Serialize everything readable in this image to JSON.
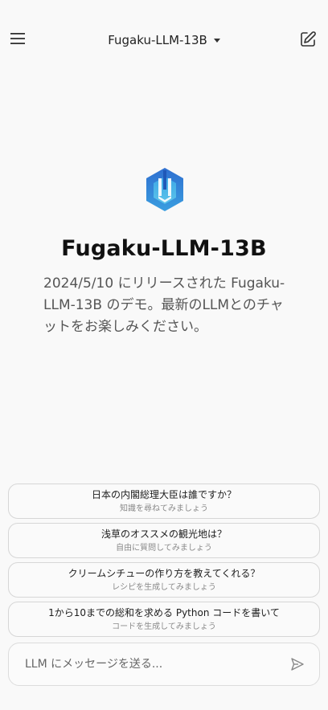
{
  "header": {
    "model_name": "Fugaku-LLM-13B",
    "menu_icon": "hamburger-menu-icon",
    "new_chat_icon": "edit-icon",
    "dropdown_icon": "caret-down-icon"
  },
  "hero": {
    "logo_icon": "fugaku-logo-icon",
    "title": "Fugaku-LLM-13B",
    "description": "2024/5/10 にリリースされた Fugaku-LLM-13B のデモ。最新のLLMとのチャットをお楽しみください。"
  },
  "suggestions": [
    {
      "title": "日本の内閣総理大臣は誰ですか？",
      "subtitle": "知識を尋ねてみましょう"
    },
    {
      "title": "浅草のオススメの観光地は？",
      "subtitle": "自由に質問してみましょう"
    },
    {
      "title": "クリームシチューの作り方を教えてくれる？",
      "subtitle": "レシピを生成してみましょう"
    },
    {
      "title": "1から10までの総和を求める Python コードを書いて",
      "subtitle": "コードを生成してみましょう"
    }
  ],
  "composer": {
    "placeholder": "LLM にメッセージを送る...",
    "send_icon": "send-icon"
  },
  "colors": {
    "background": "#f9f9f9",
    "logo_blue": "#2f7fd6",
    "logo_light_blue": "#45b6e6"
  }
}
